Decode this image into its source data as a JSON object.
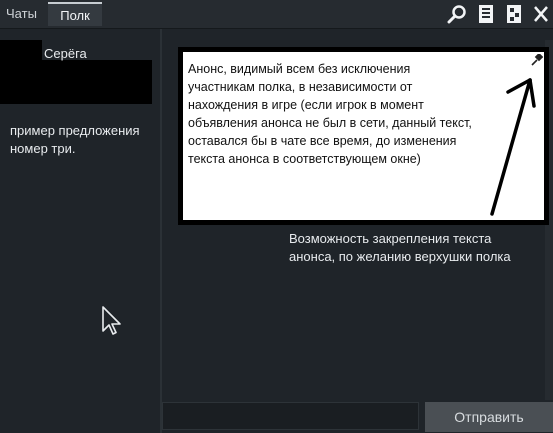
{
  "tabs": [
    {
      "label": "Чаты",
      "active": false
    },
    {
      "label": "Полк",
      "active": true
    }
  ],
  "toolbar_icons": [
    "search-icon",
    "document-icon",
    "document-edit-icon",
    "close-icon"
  ],
  "contacts": [
    {
      "name": "Серёга"
    }
  ],
  "left_panel": {
    "suggestion_text": "пример предложения номер три."
  },
  "announcement": {
    "text": "Анонс, видимый всем без исключения участникам полка, в независимости от нахождения в игре (если игрок в момент объявления анонса не был в сети, данный текст, оставался бы в чате все время, до изменения текста анонса в соответствующем окне)",
    "pin_icon": "pin-icon"
  },
  "pin_hint": "Возможность закрепления текста анонса, по желанию верхушки полка",
  "composer": {
    "input_value": "",
    "send_label": "Отправить"
  },
  "colors": {
    "background": "#1f2429",
    "topbar": "#262b30",
    "active_tab": "#343a40",
    "send_button": "#4a4f54",
    "announcement_bg": "#ffffff",
    "announcement_border": "#000000"
  }
}
